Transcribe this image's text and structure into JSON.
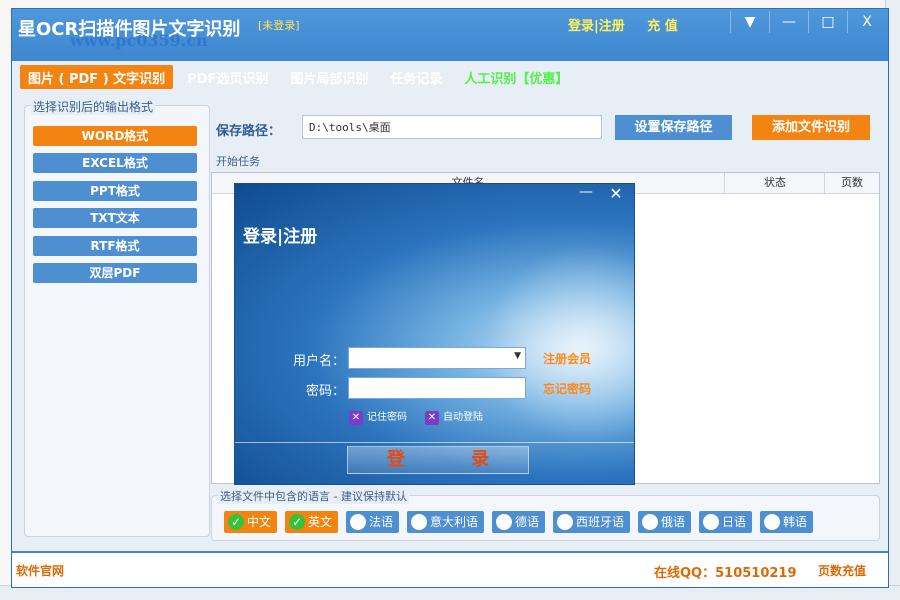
{
  "app": {
    "title": "星OCR扫描件图片文字识别",
    "not_logged": "[未登录]",
    "watermark": "www.pc0359.cn",
    "top_links": [
      "登录|注册",
      "充 值"
    ],
    "window_controls": [
      "▼",
      "—",
      "□",
      "X"
    ]
  },
  "tabs": [
    {
      "label": "图片 ( PDF ) 文字识别",
      "active": true
    },
    {
      "label": "PDF选页识别",
      "active": false
    },
    {
      "label": "图片局部识别",
      "active": false
    },
    {
      "label": "任务记录",
      "active": false
    },
    {
      "label": "人工识别【优惠】",
      "active": false,
      "green": true
    }
  ],
  "left_panel": {
    "title": "选择识别后的输出格式",
    "formats": [
      {
        "label": "WORD格式",
        "active": true
      },
      {
        "label": "EXCEL格式",
        "active": false
      },
      {
        "label": "PPT格式",
        "active": false
      },
      {
        "label": "TXT文本",
        "active": false
      },
      {
        "label": "RTF格式",
        "active": false
      },
      {
        "label": "双层PDF",
        "active": false
      }
    ]
  },
  "save": {
    "label": "保存路径：",
    "path": "D:\\tools\\桌面",
    "set_path_button": "设置保存路径",
    "add_file_button": "添加文件识别"
  },
  "task": {
    "label": "开始任务",
    "columns": [
      "文件名",
      "状态",
      "页数"
    ]
  },
  "languages": {
    "title": "选择文件中包含的语言  -  建议保持默认",
    "items": [
      {
        "label": "中文",
        "selected": true
      },
      {
        "label": "英文",
        "selected": true
      },
      {
        "label": "法语",
        "selected": false
      },
      {
        "label": "意大利语",
        "selected": false
      },
      {
        "label": "德语",
        "selected": false
      },
      {
        "label": "西班牙语",
        "selected": false
      },
      {
        "label": "俄语",
        "selected": false
      },
      {
        "label": "日语",
        "selected": false
      },
      {
        "label": "韩语",
        "selected": false
      }
    ]
  },
  "footer": {
    "left": "软件官网",
    "qq": "在线QQ：510510219",
    "right": "页数充值"
  },
  "dialog": {
    "title": "登录|注册",
    "minimize": "—",
    "close": "✕",
    "username_label": "用户名：",
    "password_label": "密码：",
    "register_link": "注册会员",
    "forgot_link": "忘记密码",
    "remember_label": "记住密码",
    "autologin_label": "自动登陆",
    "login_button": "登 录"
  },
  "colors": {
    "accent_orange": "#f48411",
    "accent_blue": "#4e8fd1",
    "titlebar_blue": "#3e86cf"
  }
}
